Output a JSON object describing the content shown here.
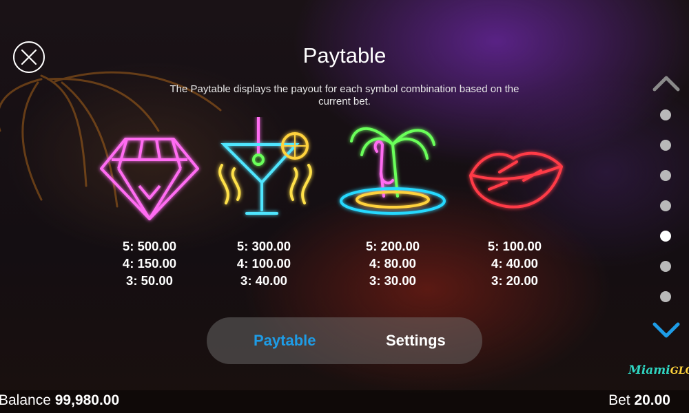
{
  "header": {
    "title": "Paytable",
    "description": "The Paytable displays the payout for each symbol combination based on the current bet."
  },
  "symbols": [
    {
      "icon": "diamond-icon",
      "color": "#ff5cf0",
      "payouts": [
        "5: 500.00",
        "4: 150.00",
        "3: 50.00"
      ]
    },
    {
      "icon": "cocktail-icon",
      "color": "#4fe6ff",
      "payouts": [
        "5: 300.00",
        "4: 100.00",
        "3: 40.00"
      ]
    },
    {
      "icon": "flamingo-palm-icon",
      "color": "#6bff5a",
      "payouts": [
        "5: 200.00",
        "4: 80.00",
        "3: 30.00"
      ]
    },
    {
      "icon": "lips-icon",
      "color": "#ff3a46",
      "payouts": [
        "5: 100.00",
        "4: 40.00",
        "3: 20.00"
      ]
    }
  ],
  "pagination": {
    "total": 7,
    "active_index": 4,
    "accent": "#1e9ce6"
  },
  "tabs": {
    "paytable": "Paytable",
    "settings": "Settings",
    "active": "paytable"
  },
  "logo": {
    "line1": "Miami",
    "line2": "GLOW"
  },
  "footer": {
    "balance_label": "Balance",
    "balance_value": "99,980.00",
    "bet_label": "Bet",
    "bet_value": "20.00"
  }
}
